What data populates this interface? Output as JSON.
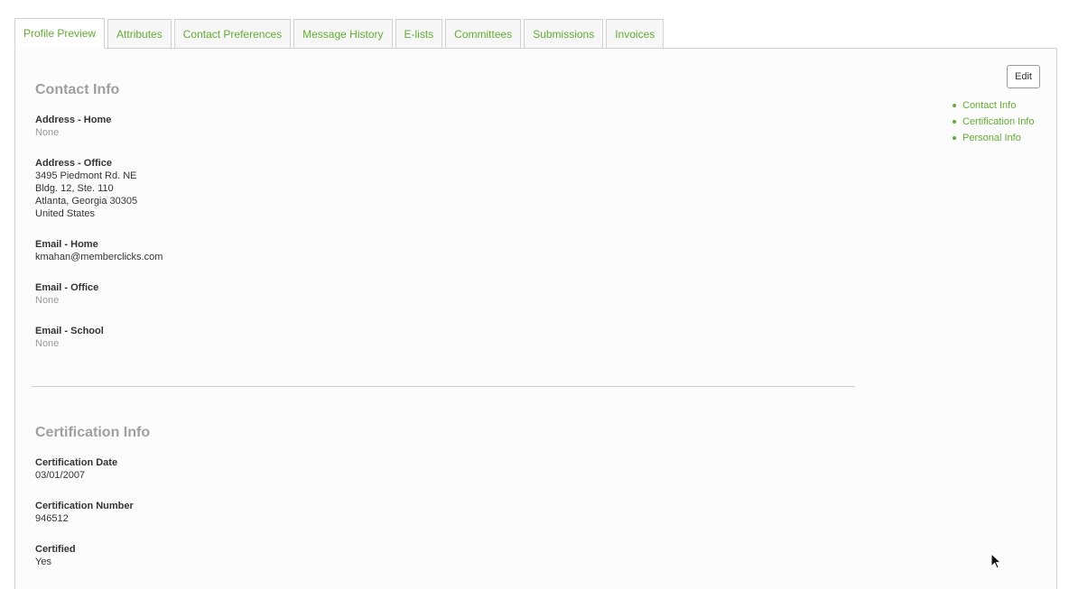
{
  "tabs": [
    {
      "label": "Profile Preview",
      "active": true
    },
    {
      "label": "Attributes",
      "active": false
    },
    {
      "label": "Contact Preferences",
      "active": false
    },
    {
      "label": "Message History",
      "active": false
    },
    {
      "label": "E-lists",
      "active": false
    },
    {
      "label": "Committees",
      "active": false
    },
    {
      "label": "Submissions",
      "active": false
    },
    {
      "label": "Invoices",
      "active": false
    }
  ],
  "actions": {
    "edit_label": "Edit"
  },
  "side_nav": [
    {
      "label": "Contact Info"
    },
    {
      "label": "Certification Info"
    },
    {
      "label": "Personal Info"
    }
  ],
  "contact_info": {
    "title": "Contact Info",
    "fields": [
      {
        "label": "Address - Home",
        "value": "None",
        "empty": true
      },
      {
        "label": "Address - Office",
        "lines": [
          "3495 Piedmont Rd. NE",
          "Bldg. 12, Ste. 110",
          "Atlanta, Georgia 30305",
          "United States"
        ]
      },
      {
        "label": "Email - Home",
        "value": "kmahan@memberclicks.com",
        "empty": false
      },
      {
        "label": "Email - Office",
        "value": "None",
        "empty": true
      },
      {
        "label": "Email - School",
        "value": "None",
        "empty": true
      }
    ]
  },
  "certification_info": {
    "title": "Certification Info",
    "fields": [
      {
        "label": "Certification Date",
        "value": "03/01/2007",
        "empty": false
      },
      {
        "label": "Certification Number",
        "value": "946512",
        "empty": false
      },
      {
        "label": "Certified",
        "value": "Yes",
        "empty": false
      }
    ]
  },
  "colors": {
    "accent_green": "#5fae2e",
    "section_title_gray": "#9f9f9f",
    "empty_value_gray": "#9a9a9a",
    "border_gray": "#d0d0d0"
  },
  "icons": {
    "cursor": "mouse-pointer-icon"
  }
}
